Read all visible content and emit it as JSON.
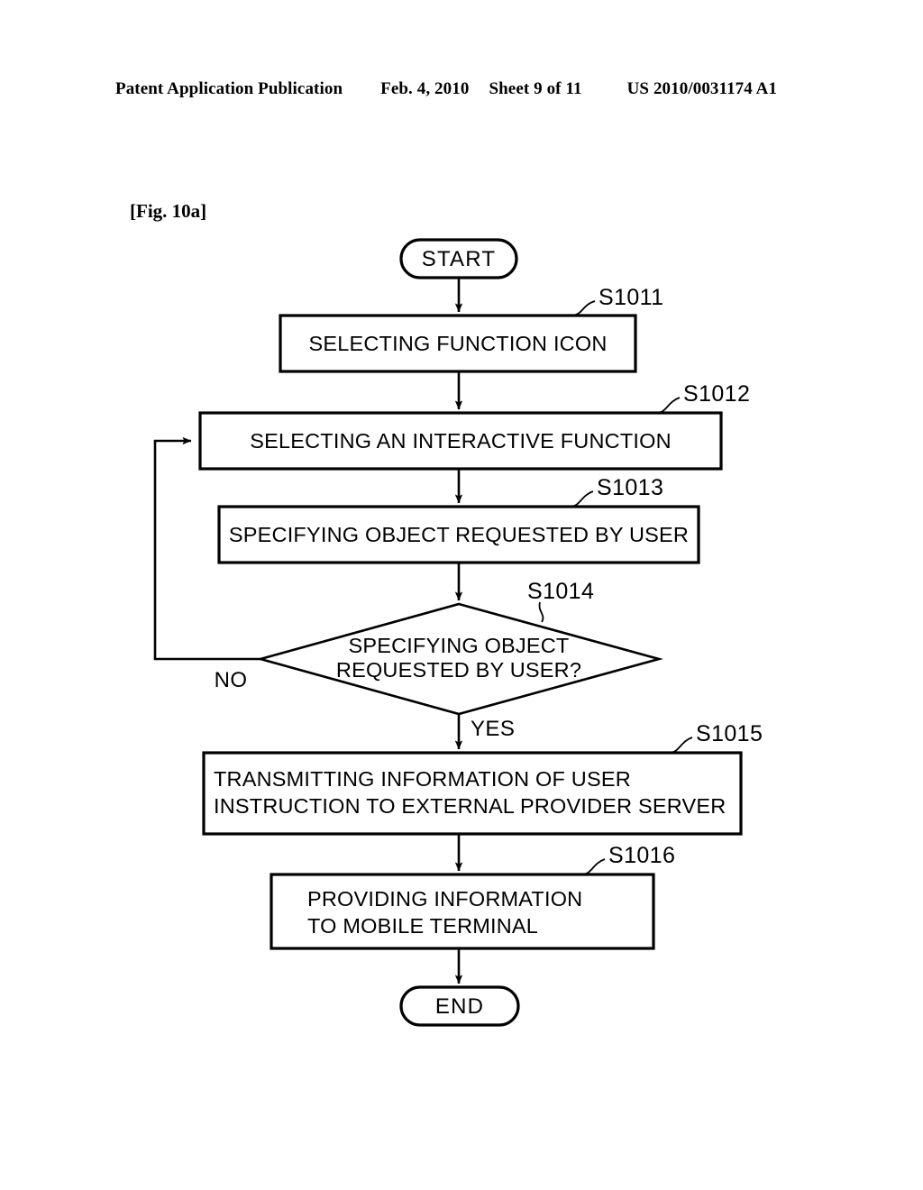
{
  "header": {
    "publication": "Patent Application Publication",
    "date": "Feb. 4, 2010",
    "sheet": "Sheet 9 of 11",
    "patent_number": "US 2010/0031174 A1"
  },
  "figure": {
    "label": "[Fig. 10a]"
  },
  "flowchart": {
    "start_label": "START",
    "end_label": "END",
    "branch_no": "NO",
    "branch_yes": "YES",
    "steps": [
      {
        "tag": "S1011",
        "lines": [
          "SELECTING FUNCTION ICON"
        ],
        "shape": "process"
      },
      {
        "tag": "S1012",
        "lines": [
          "SELECTING AN INTERACTIVE FUNCTION"
        ],
        "shape": "process"
      },
      {
        "tag": "S1013",
        "lines": [
          "SPECIFYING OBJECT REQUESTED BY USER"
        ],
        "shape": "process"
      },
      {
        "tag": "S1014",
        "lines": [
          "SPECIFYING OBJECT",
          "REQUESTED BY USER?"
        ],
        "shape": "decision"
      },
      {
        "tag": "S1015",
        "lines": [
          "TRANSMITTING INFORMATION OF USER",
          "INSTRUCTION TO EXTERNAL PROVIDER SERVER"
        ],
        "shape": "process"
      },
      {
        "tag": "S1016",
        "lines": [
          "PROVIDING INFORMATION",
          "TO MOBILE TERMINAL"
        ],
        "shape": "process"
      }
    ]
  },
  "colors": {
    "ink": "#000000",
    "paper": "#ffffff"
  }
}
